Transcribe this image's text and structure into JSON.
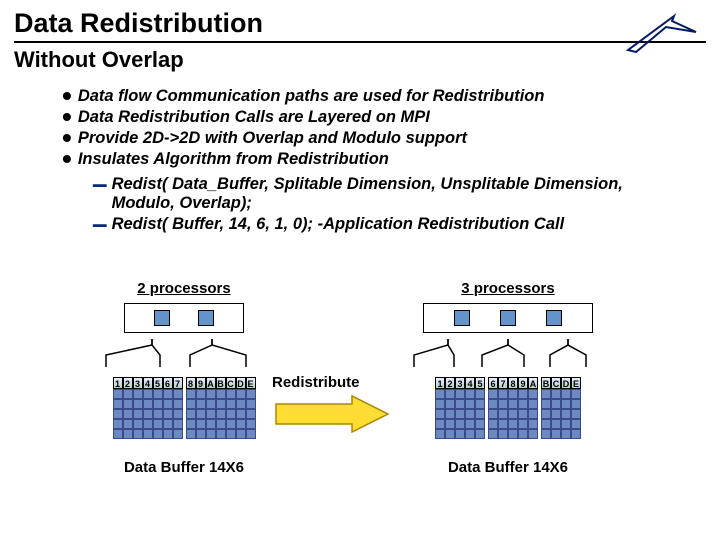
{
  "title": "Data Redistribution",
  "subtitle": "Without Overlap",
  "bullets": [
    "Data flow Communication paths are used for Redistribution",
    "Data Redistribution Calls are Layered on MPI",
    "Provide 2D->2D with Overlap and Modulo support",
    "Insulates Algorithm from Redistribution"
  ],
  "sub_bullets": [
    "Redist( Data_Buffer, Splitable Dimension, Unsplitable Dimension, Modulo, Overlap);",
    "Redist( Buffer, 14, 6, 1, 0); -Application Redistribution Call"
  ],
  "left": {
    "proc_label": "2 processors",
    "buf_label": "Data Buffer 14X6",
    "headers": [
      "1234567",
      "89ABCDE"
    ]
  },
  "right": {
    "proc_label": "3 processors",
    "buf_label": "Data Buffer 14X6",
    "headers": [
      "12345",
      "6789A",
      "BCDE"
    ]
  },
  "redistribute_label": "Redistribute",
  "colors": {
    "accent": "#0a2a7a",
    "grid": "#6d89c2"
  }
}
